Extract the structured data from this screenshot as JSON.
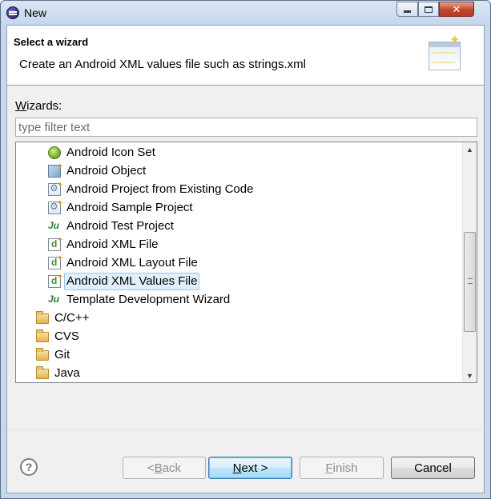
{
  "window": {
    "title": "New"
  },
  "header": {
    "title": "Select a wizard",
    "description": "Create an Android XML values file such as strings.xml"
  },
  "wizards": {
    "label_mnemonic": "W",
    "label_rest": "izards:",
    "filter_placeholder": "type filter text",
    "filter_value": ""
  },
  "tree": {
    "items": [
      {
        "label": "Android Icon Set",
        "icon": "android-icon-set-icon"
      },
      {
        "label": "Android Object",
        "icon": "android-object-icon"
      },
      {
        "label": "Android Project from Existing Code",
        "icon": "android-project-icon"
      },
      {
        "label": "Android Sample Project",
        "icon": "android-project-icon"
      },
      {
        "label": "Android Test Project",
        "icon": "junit-icon"
      },
      {
        "label": "Android XML File",
        "icon": "android-xml-icon"
      },
      {
        "label": "Android XML Layout File",
        "icon": "android-xml-icon"
      },
      {
        "label": "Android XML Values File",
        "icon": "android-xml-icon",
        "selected": true
      },
      {
        "label": "Template Development Wizard",
        "icon": "junit-icon"
      }
    ],
    "categories": [
      {
        "label": "C/C++"
      },
      {
        "label": "CVS"
      },
      {
        "label": "Git"
      },
      {
        "label": "Java"
      }
    ]
  },
  "buttons": {
    "back_prefix": "< ",
    "back_mnemonic": "B",
    "back_rest": "ack",
    "next_mnemonic": "N",
    "next_rest": "ext >",
    "finish_mnemonic": "F",
    "finish_rest": "inish",
    "cancel": "Cancel",
    "help": "?"
  },
  "colors": {
    "selection_bg": "#e3eefb",
    "selection_border": "#9ac3ec",
    "default_button_border": "#3c7fb1"
  }
}
